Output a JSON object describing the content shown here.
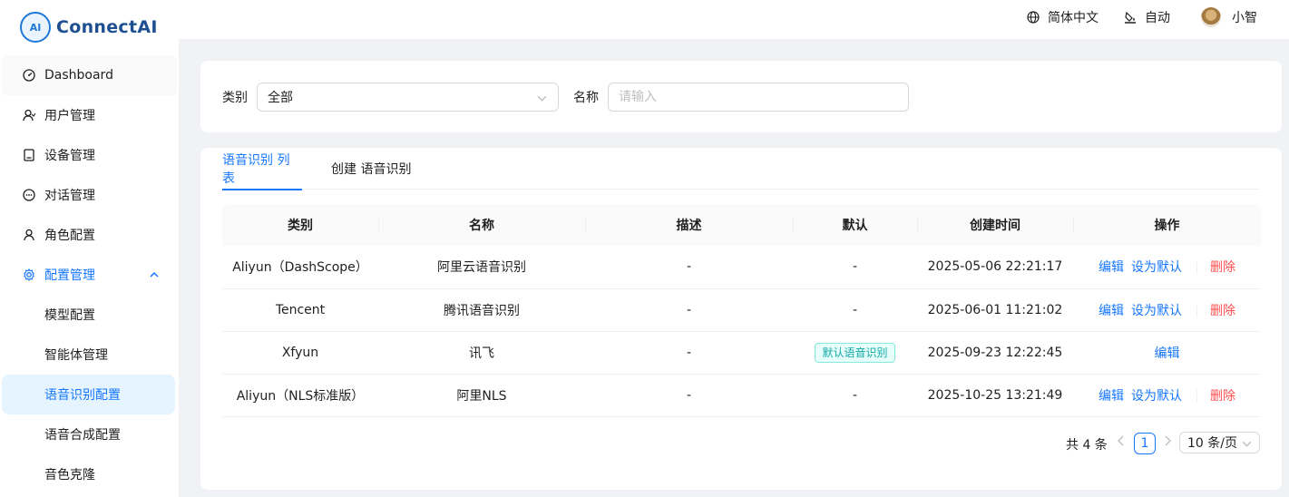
{
  "brand": {
    "name_prefix": "Connect",
    "name_suffix": "AI",
    "mark": "AI"
  },
  "header": {
    "language": "简体中文",
    "theme": "自动",
    "user": "小智"
  },
  "sidebar": {
    "items": [
      {
        "label": "Dashboard",
        "icon": "dashboard-icon"
      },
      {
        "label": "用户管理",
        "icon": "user-icon"
      },
      {
        "label": "设备管理",
        "icon": "device-icon"
      },
      {
        "label": "对话管理",
        "icon": "chat-icon"
      },
      {
        "label": "角色配置",
        "icon": "role-icon"
      },
      {
        "label": "配置管理",
        "icon": "gear-icon"
      }
    ],
    "sub_items": [
      {
        "label": "模型配置"
      },
      {
        "label": "智能体管理"
      },
      {
        "label": "语音识别配置"
      },
      {
        "label": "语音合成配置"
      },
      {
        "label": "音色克隆"
      }
    ]
  },
  "filter": {
    "category_label": "类别",
    "category_value": "全部",
    "name_label": "名称",
    "name_placeholder": "请输入"
  },
  "tabs": [
    {
      "label": "语音识别 列表"
    },
    {
      "label": "创建 语音识别"
    }
  ],
  "table": {
    "columns": [
      "类别",
      "名称",
      "描述",
      "默认",
      "创建时间",
      "操作"
    ],
    "rows": [
      {
        "category": "Aliyun（DashScope）",
        "name": "阿里云语音识别",
        "desc": "-",
        "default": "-",
        "created": "2025-05-06 22:21:17"
      },
      {
        "category": "Tencent",
        "name": "腾讯语音识别",
        "desc": "-",
        "default": "-",
        "created": "2025-06-01 11:21:02"
      },
      {
        "category": "Xfyun",
        "name": "讯飞",
        "desc": "-",
        "default_tag": "默认语音识别",
        "created": "2025-09-23 12:22:45"
      },
      {
        "category": "Aliyun（NLS标准版）",
        "name": "阿里NLS",
        "desc": "-",
        "default": "-",
        "created": "2025-10-25 13:21:49"
      }
    ],
    "actions": {
      "edit": "编辑",
      "set_default": "设为默认",
      "delete": "删除"
    }
  },
  "pagination": {
    "total": "共 4 条",
    "current_page": "1",
    "page_size": "10 条/页"
  },
  "colors": {
    "primary": "#1677ff",
    "danger": "#ff4d4f",
    "tag": "#13a8a8"
  }
}
